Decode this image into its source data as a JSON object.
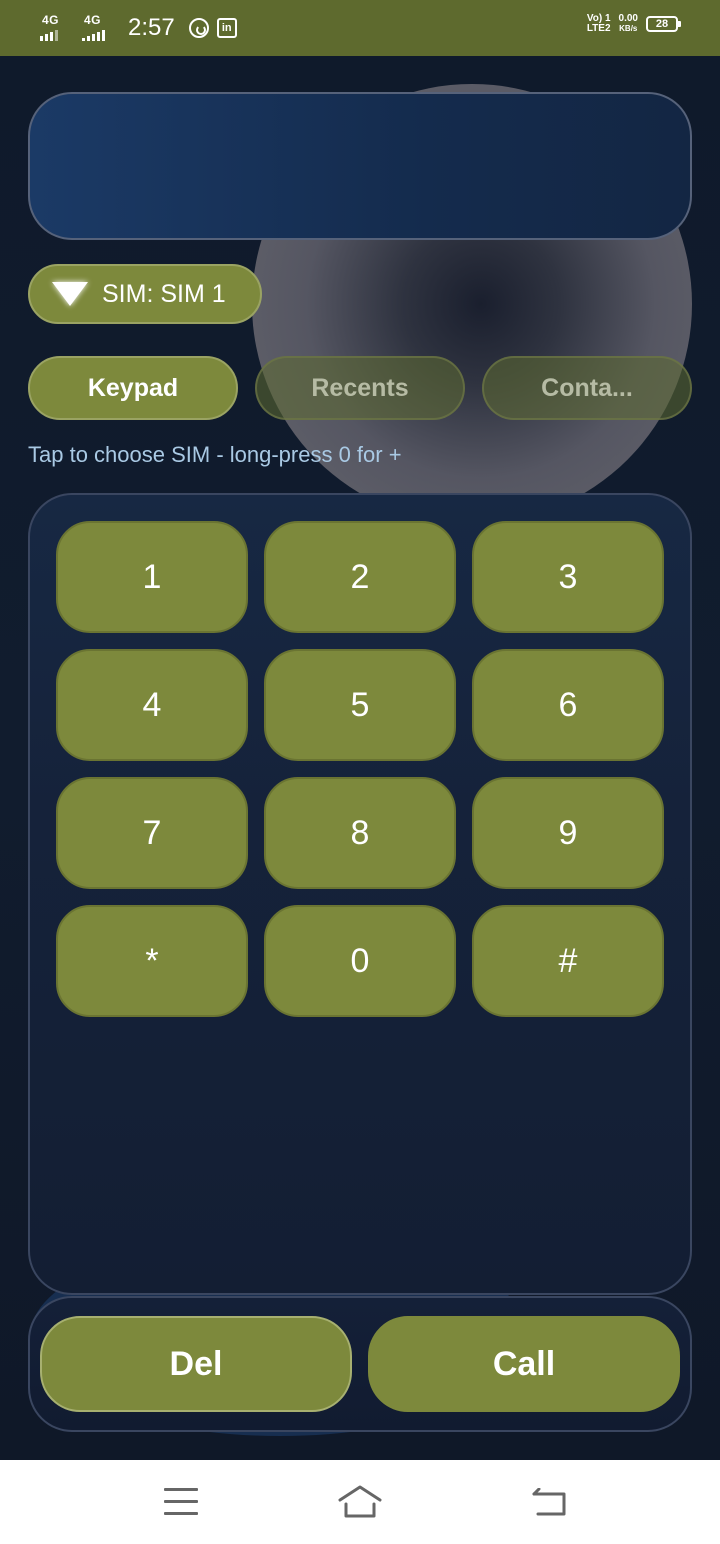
{
  "status_bar": {
    "net1": "4G",
    "net2": "4G",
    "time": "2:57",
    "volte_line1": "Vo) 1",
    "volte_line2": "LTE2",
    "speed_value": "0.00",
    "speed_unit": "KB/s",
    "battery": "28"
  },
  "display": {
    "number": ""
  },
  "sim": {
    "label": "SIM: SIM 1"
  },
  "tabs": [
    {
      "label": "Keypad",
      "active": true
    },
    {
      "label": "Recents",
      "active": false
    },
    {
      "label": "Conta...",
      "active": false
    }
  ],
  "hint": "Tap to choose SIM - long-press 0 for +",
  "keys": [
    "1",
    "2",
    "3",
    "4",
    "5",
    "6",
    "7",
    "8",
    "9",
    "*",
    "0",
    "#"
  ],
  "actions": {
    "delete": "Del",
    "call": "Call"
  },
  "colors": {
    "status_bar": "#5e6a2e",
    "accent": "#7d893c",
    "background": "#0f1a2b",
    "hint_text": "#a9c9e4"
  },
  "nav_icons": [
    "menu-icon",
    "home-icon",
    "back-icon"
  ]
}
